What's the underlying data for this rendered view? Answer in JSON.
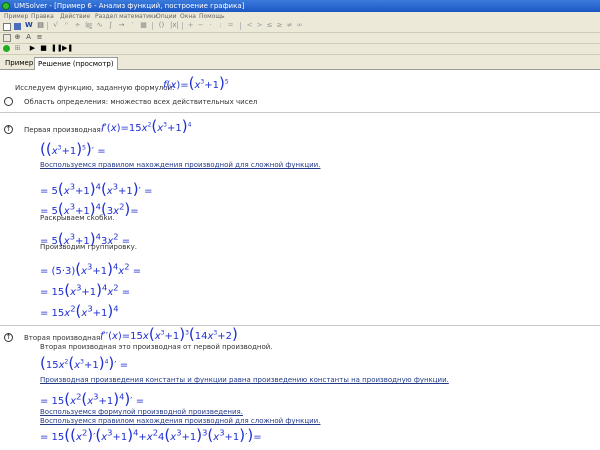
{
  "window": {
    "title": "UMSolver - [Пример 6 - Анализ функций, построение графика]"
  },
  "menu": [
    "Пример",
    "Правка",
    "Действие",
    "Раздел математики",
    "Опции",
    "Окна",
    "Помощь"
  ],
  "tabs": [
    {
      "label": "Пример"
    },
    {
      "label": "Решение (просмотр)"
    }
  ],
  "content": {
    "intro": "Исследуем функцию, заданную формулой:",
    "domain": "Область определения: множество всех действительных чисел",
    "first_deriv_label": "Первая производная:",
    "s1_note": "Воспользуемся правилом нахождения производной для сложной функции.",
    "s3_note": "Раскрываем скобки.",
    "s4_note": "Производим группировку.",
    "second_deriv_label": "Вторая производная:",
    "d2_note": "Вторая производная это производная от первой производной.",
    "d2_s1_note": "Производная произведения константы и функции равна произведению константы на производную функции.",
    "d2_s2_note1": "Воспользуемся формулой производной произведения.",
    "d2_s2_note2": "Воспользуемся правилом нахождения производной для сложной функции."
  }
}
